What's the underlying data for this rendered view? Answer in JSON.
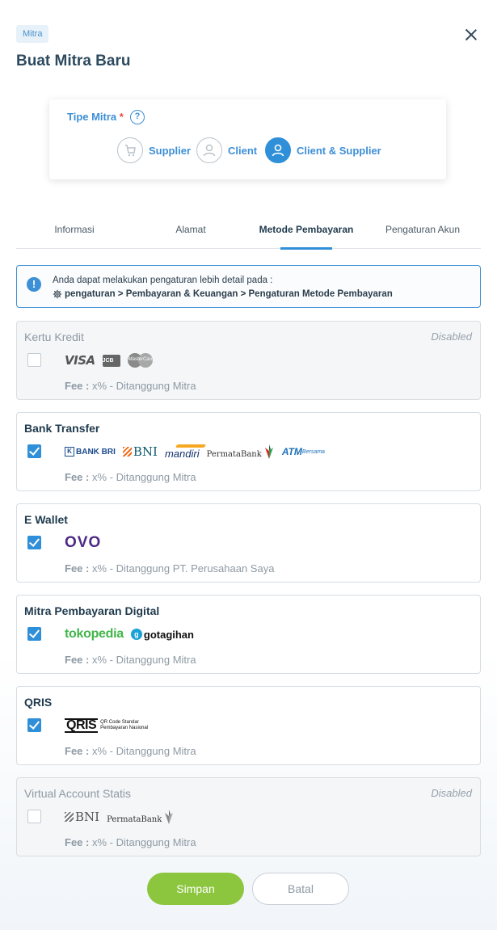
{
  "header": {
    "badge": "Mitra",
    "title": "Buat Mitra Baru"
  },
  "partner_type": {
    "label": "Tipe Mitra",
    "required_mark": "*",
    "help_icon": "question-circle-icon",
    "options": [
      {
        "label": "Supplier",
        "icon": "cart-icon",
        "selected": false
      },
      {
        "label": "Client",
        "icon": "user-icon",
        "selected": false
      },
      {
        "label": "Client & Supplier",
        "icon": "user-icon",
        "selected": true
      }
    ]
  },
  "tabs": [
    {
      "label": "Informasi",
      "active": false
    },
    {
      "label": "Alamat",
      "active": false
    },
    {
      "label": "Metode Pembayaran",
      "active": true
    },
    {
      "label": "Pengaturan Akun",
      "active": false
    }
  ],
  "info": {
    "line1": "Anda dapat melakukan pengaturan lebih detail pada :",
    "line2": "pengaturan > Pembayaran & Keuangan > Pengaturan Metode Pembayaran"
  },
  "payment_methods": [
    {
      "title": "Kertu Kredit",
      "status": "Disabled",
      "checked": false,
      "fee_label": "Fee :",
      "fee_text": "x% - Ditanggung Mitra",
      "logos": [
        "VISA",
        "JCB",
        "MasterCard"
      ]
    },
    {
      "title": "Bank Transfer",
      "status": "",
      "checked": true,
      "fee_label": "Fee :",
      "fee_text": "x% - Ditanggung Mitra",
      "logos": [
        "BANK BRI",
        "BNI",
        "mandiri",
        "PermataBank",
        "ATM",
        "Bersama"
      ]
    },
    {
      "title": "E Wallet",
      "status": "",
      "checked": true,
      "fee_label": "Fee :",
      "fee_text": "x% - Ditanggung PT. Perusahaan Saya",
      "logos": [
        "OVO"
      ]
    },
    {
      "title": "Mitra Pembayaran Digital",
      "status": "",
      "checked": true,
      "fee_label": "Fee :",
      "fee_text": "x% - Ditanggung Mitra",
      "logos": [
        "tokopedia",
        "gotagihan"
      ]
    },
    {
      "title": "QRIS",
      "status": "",
      "checked": true,
      "fee_label": "Fee :",
      "fee_text": "x% - Ditanggung Mitra",
      "logos": [
        "QRIS",
        "QR Code Standar",
        "Pembayaran Nasional"
      ]
    },
    {
      "title": "Virtual Account Statis",
      "status": "Disabled",
      "checked": false,
      "fee_label": "Fee :",
      "fee_text": "x% - Ditanggung Mitra",
      "logos": [
        "BNI",
        "PermataBank"
      ]
    }
  ],
  "actions": {
    "save": "Simpan",
    "cancel": "Batal"
  },
  "colors": {
    "primary": "#2f8fd8",
    "save": "#8cc63f",
    "required": "#e74c3c"
  }
}
